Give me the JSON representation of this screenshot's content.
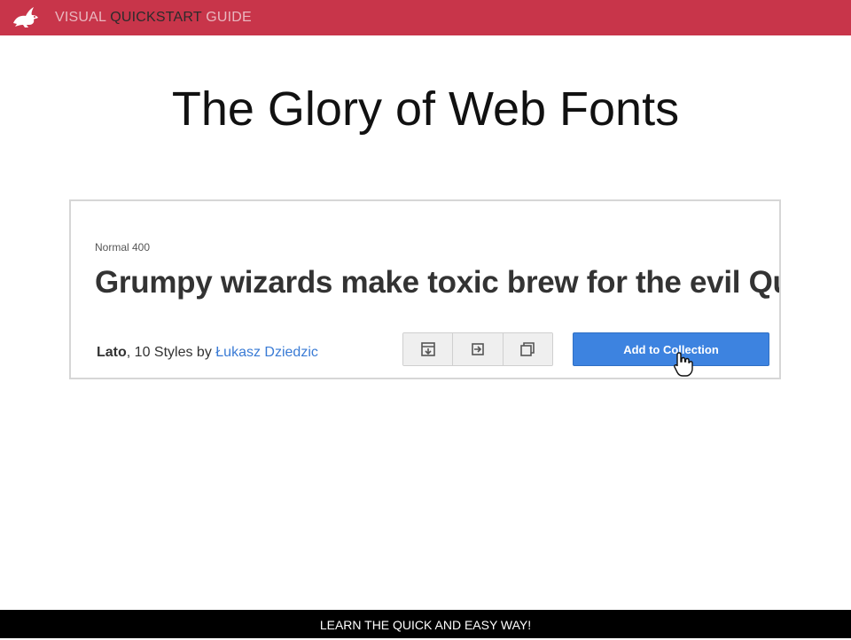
{
  "header": {
    "brand_part1": "VISUAL",
    "brand_part2": "QUICKSTART",
    "brand_part3": "GUIDE",
    "logo_icon": "rabbit-logo-icon",
    "bg_color": "#c8354a"
  },
  "slide": {
    "title": "The Glory of Web Fonts"
  },
  "font_card": {
    "style_label": "Normal 400",
    "sample_text": "Grumpy wizards make toxic brew for the evil Queen and Jack.",
    "font_name": "Lato",
    "styles_count_text": ", 10 Styles by ",
    "author": "Łukasz Dziedzic",
    "icon_buttons": [
      "download-icon",
      "quick-use-icon",
      "pop-out-icon"
    ],
    "add_button_label": "Add to Collection",
    "accent_color": "#3d83e0"
  },
  "footer": {
    "tagline": "LEARN THE QUICK AND EASY WAY!"
  }
}
